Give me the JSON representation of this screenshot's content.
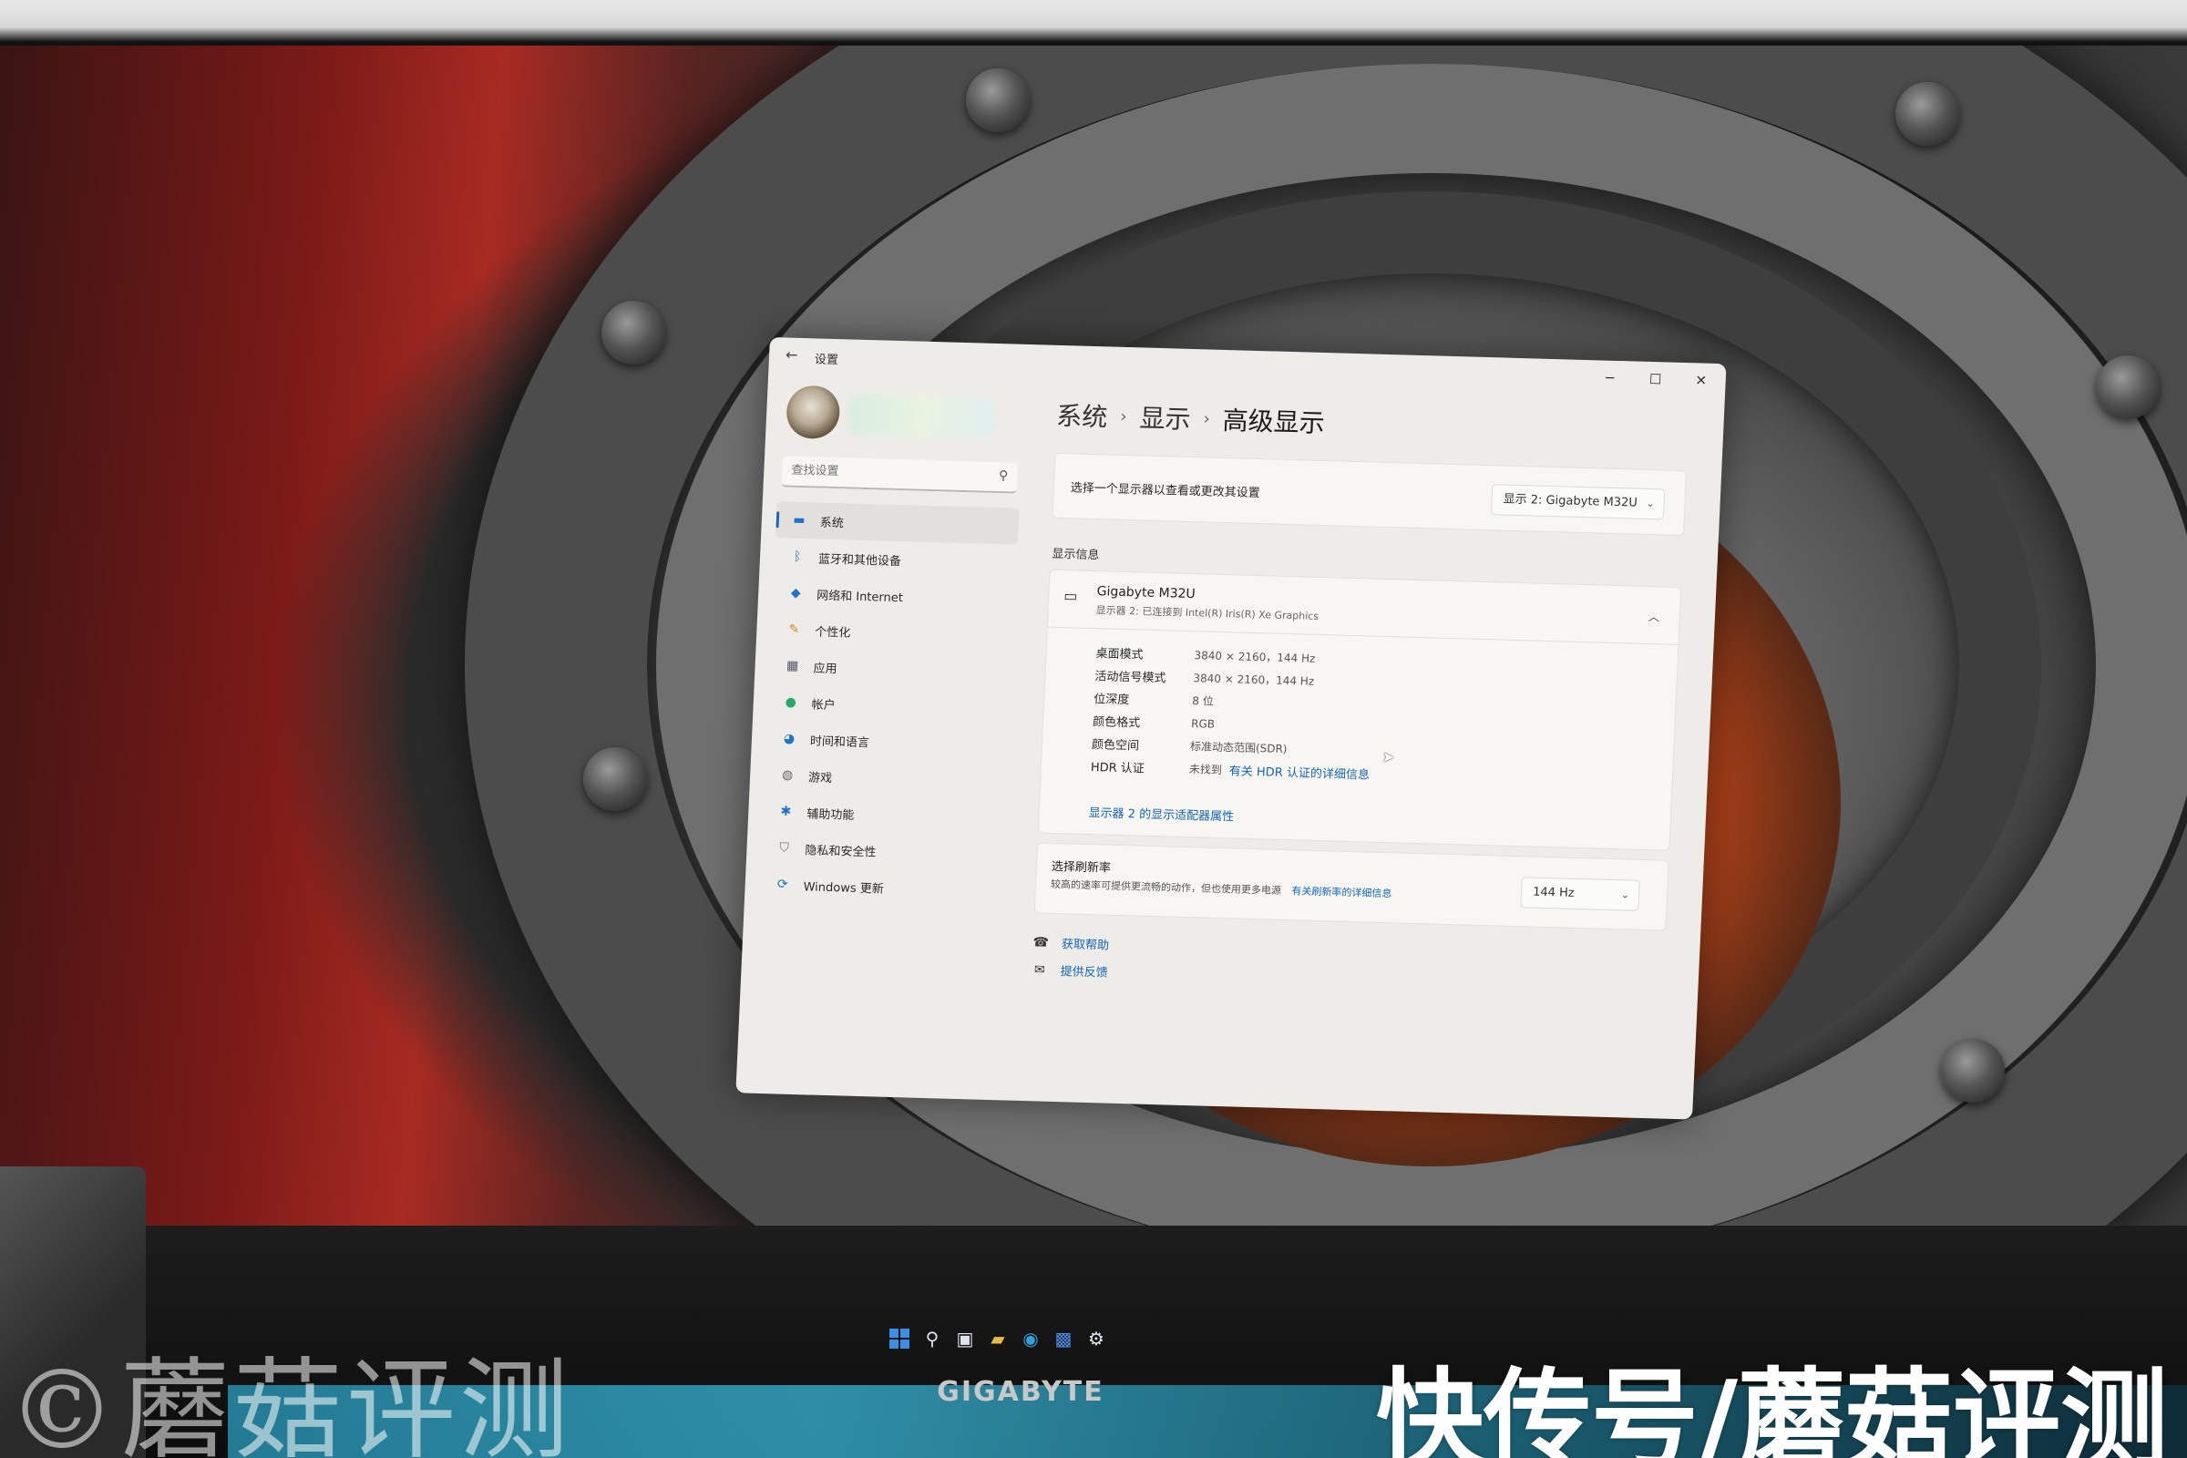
{
  "window": {
    "app_title": "设置",
    "controls": {
      "minimize": "─",
      "maximize": "☐",
      "close": "✕"
    }
  },
  "search": {
    "placeholder": "查找设置"
  },
  "sidebar": {
    "items": [
      {
        "label": "系统",
        "icon": "display-icon",
        "active": true
      },
      {
        "label": "蓝牙和其他设备",
        "icon": "bluetooth-icon"
      },
      {
        "label": "网络和 Internet",
        "icon": "wifi-icon"
      },
      {
        "label": "个性化",
        "icon": "brush-icon"
      },
      {
        "label": "应用",
        "icon": "apps-icon"
      },
      {
        "label": "帐户",
        "icon": "person-icon"
      },
      {
        "label": "时间和语言",
        "icon": "globe-clock-icon"
      },
      {
        "label": "游戏",
        "icon": "gamepad-icon"
      },
      {
        "label": "辅助功能",
        "icon": "accessibility-icon"
      },
      {
        "label": "隐私和安全性",
        "icon": "shield-icon"
      },
      {
        "label": "Windows 更新",
        "icon": "update-icon"
      }
    ]
  },
  "breadcrumb": {
    "part1": "系统",
    "part2": "显示",
    "current": "高级显示"
  },
  "display_select": {
    "label": "选择一个显示器以查看或更改其设置",
    "value": "显示 2: Gigabyte M32U"
  },
  "display_info": {
    "section_title": "显示信息",
    "monitor_name": "Gigabyte M32U",
    "monitor_sub": "显示器 2: 已连接到 Intel(R) Iris(R) Xe Graphics",
    "props": [
      {
        "k": "桌面模式",
        "v": "3840 × 2160，144 Hz"
      },
      {
        "k": "活动信号模式",
        "v": "3840 × 2160，144 Hz"
      },
      {
        "k": "位深度",
        "v": "8 位"
      },
      {
        "k": "颜色格式",
        "v": "RGB"
      },
      {
        "k": "颜色空间",
        "v": "标准动态范围(SDR)"
      }
    ],
    "hdr_label": "HDR 认证",
    "hdr_value": "未找到",
    "hdr_link": "有关 HDR 认证的详细信息",
    "adapter_link": "显示器 2 的显示适配器属性"
  },
  "refresh": {
    "title": "选择刷新率",
    "desc": "较高的速率可提供更流畅的动作，但也使用更多电源",
    "link": "有关刷新率的详细信息",
    "value": "144 Hz"
  },
  "help": {
    "get_help": "获取帮助",
    "feedback": "提供反馈"
  },
  "monitor_brand": "GIGABYTE",
  "watermark": {
    "left": "©蘑菇评测",
    "right": "快传号/蘑菇评测"
  },
  "colors": {
    "accent": "#1667bd",
    "link": "#1464b9",
    "window_bg": "#eeece8"
  }
}
